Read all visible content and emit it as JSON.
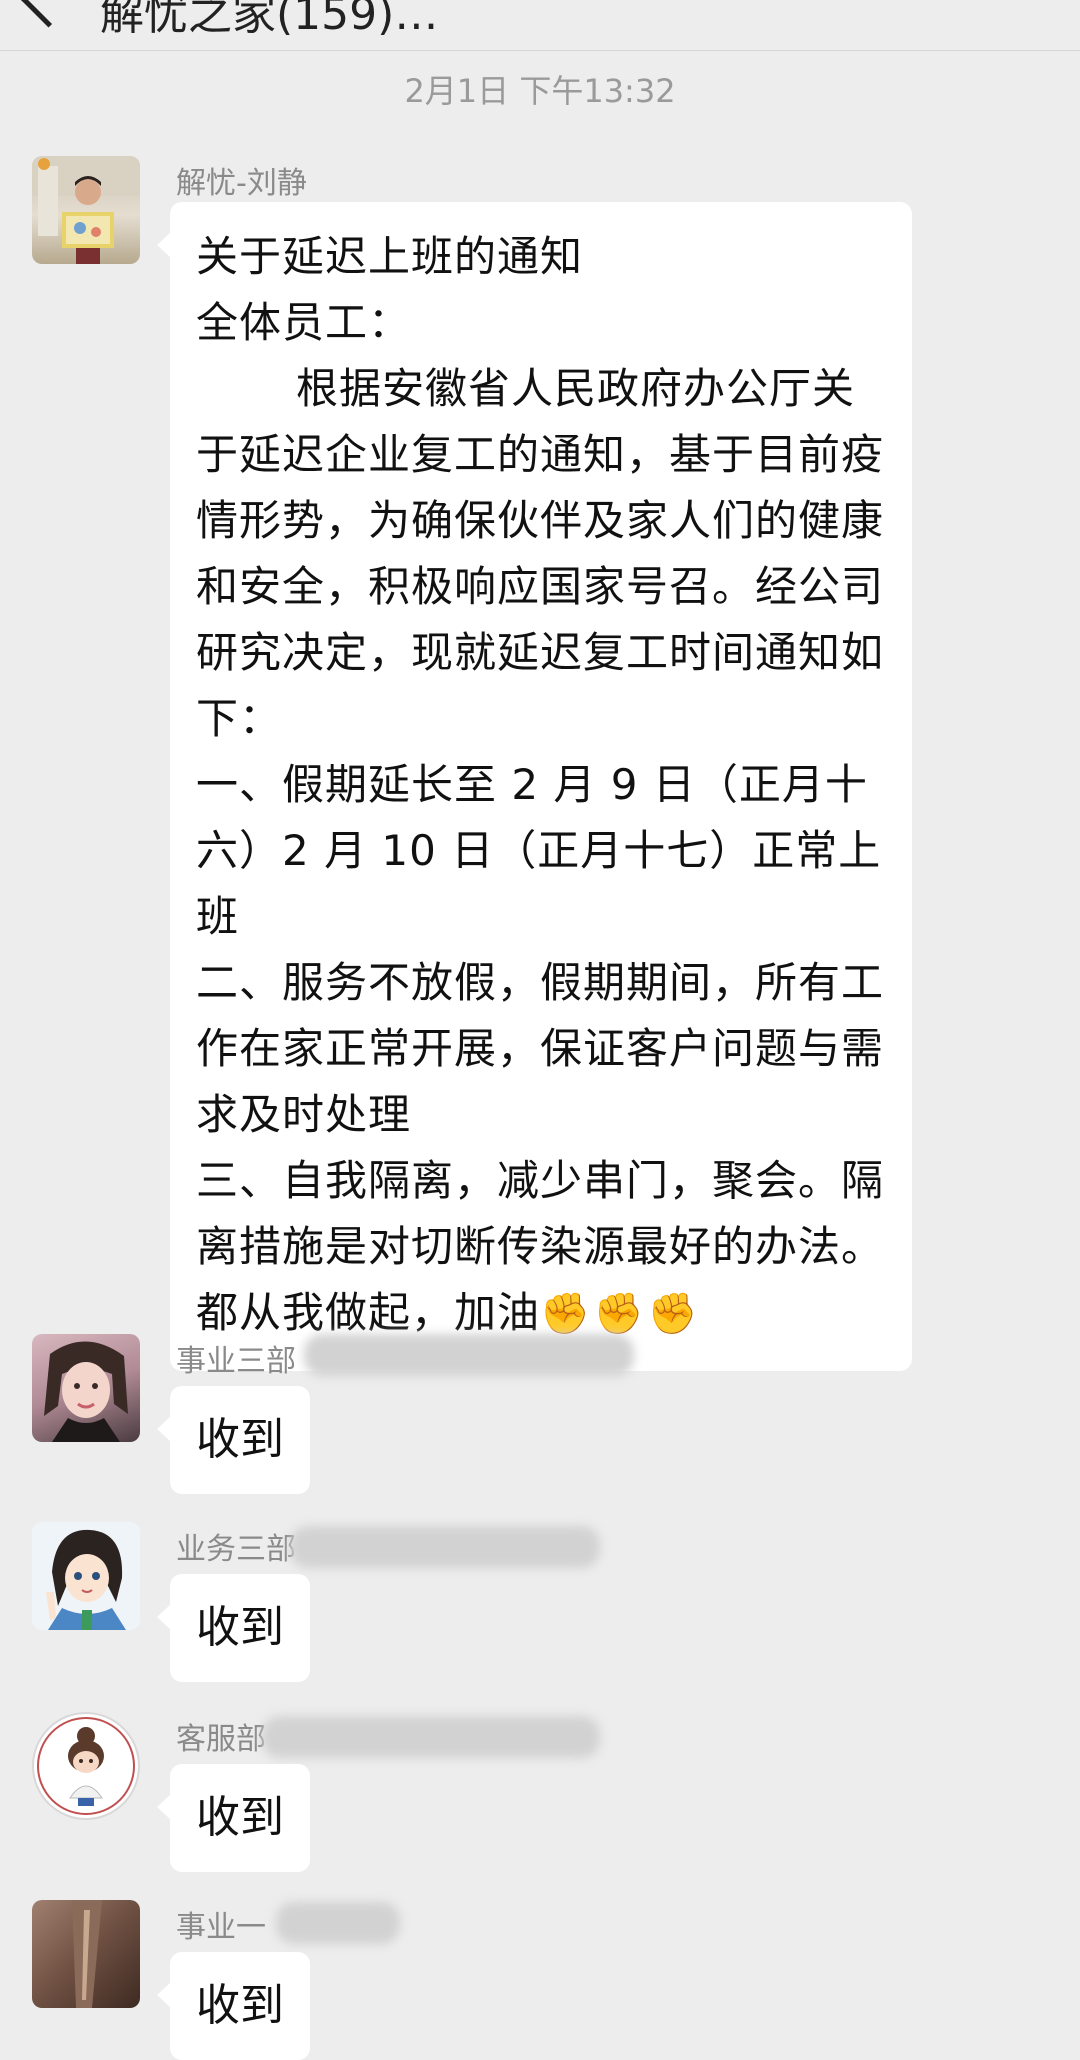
{
  "header": {
    "title": "解忧之家(159)",
    "more": "…"
  },
  "timestamp": "2月1日 下午13:32",
  "messages": [
    {
      "sender": "解忧-刘静",
      "lines": [
        "关于延迟上班的通知",
        "全体员工：",
        "根据安徽省人民政府办公厅关于延迟企业复工的通知，基于目前疫情形势，为确保伙伴及家人们的健康和安全，积极响应国家号召。经公司研究决定，现就延迟复工时间通知如下：",
        "一、假期延长至 2 月 9 日（正月十六）2 月 10 日（正月十七）正常上班",
        "二、服务不放假，假期期间，所有工作在家正常开展，保证客户问题与需求及时处理",
        "三、自我隔离，减少串门，聚会。隔离措施是对切断传染源最好的办法。",
        "都从我做起，加油"
      ],
      "emoji": "✊✊✊"
    },
    {
      "sender": "事业三部",
      "text": "收到"
    },
    {
      "sender": "业务三部",
      "text": "收到"
    },
    {
      "sender": "客服部",
      "text": "收到"
    },
    {
      "sender": "事业一",
      "text": "收到"
    }
  ]
}
